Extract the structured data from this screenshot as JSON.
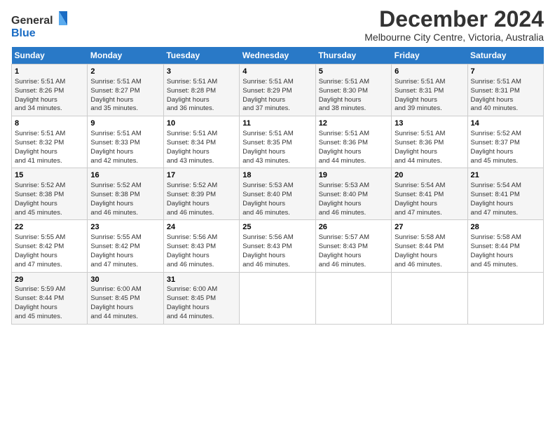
{
  "logo": {
    "line1": "General",
    "line2": "Blue"
  },
  "title": "December 2024",
  "subtitle": "Melbourne City Centre, Victoria, Australia",
  "weekdays": [
    "Sunday",
    "Monday",
    "Tuesday",
    "Wednesday",
    "Thursday",
    "Friday",
    "Saturday"
  ],
  "weeks": [
    [
      {
        "day": "1",
        "sunrise": "5:51 AM",
        "sunset": "8:26 PM",
        "daylight": "14 hours and 34 minutes."
      },
      {
        "day": "2",
        "sunrise": "5:51 AM",
        "sunset": "8:27 PM",
        "daylight": "14 hours and 35 minutes."
      },
      {
        "day": "3",
        "sunrise": "5:51 AM",
        "sunset": "8:28 PM",
        "daylight": "14 hours and 36 minutes."
      },
      {
        "day": "4",
        "sunrise": "5:51 AM",
        "sunset": "8:29 PM",
        "daylight": "14 hours and 37 minutes."
      },
      {
        "day": "5",
        "sunrise": "5:51 AM",
        "sunset": "8:30 PM",
        "daylight": "14 hours and 38 minutes."
      },
      {
        "day": "6",
        "sunrise": "5:51 AM",
        "sunset": "8:31 PM",
        "daylight": "14 hours and 39 minutes."
      },
      {
        "day": "7",
        "sunrise": "5:51 AM",
        "sunset": "8:31 PM",
        "daylight": "14 hours and 40 minutes."
      }
    ],
    [
      {
        "day": "8",
        "sunrise": "5:51 AM",
        "sunset": "8:32 PM",
        "daylight": "14 hours and 41 minutes."
      },
      {
        "day": "9",
        "sunrise": "5:51 AM",
        "sunset": "8:33 PM",
        "daylight": "14 hours and 42 minutes."
      },
      {
        "day": "10",
        "sunrise": "5:51 AM",
        "sunset": "8:34 PM",
        "daylight": "14 hours and 43 minutes."
      },
      {
        "day": "11",
        "sunrise": "5:51 AM",
        "sunset": "8:35 PM",
        "daylight": "14 hours and 43 minutes."
      },
      {
        "day": "12",
        "sunrise": "5:51 AM",
        "sunset": "8:36 PM",
        "daylight": "14 hours and 44 minutes."
      },
      {
        "day": "13",
        "sunrise": "5:51 AM",
        "sunset": "8:36 PM",
        "daylight": "14 hours and 44 minutes."
      },
      {
        "day": "14",
        "sunrise": "5:52 AM",
        "sunset": "8:37 PM",
        "daylight": "14 hours and 45 minutes."
      }
    ],
    [
      {
        "day": "15",
        "sunrise": "5:52 AM",
        "sunset": "8:38 PM",
        "daylight": "14 hours and 45 minutes."
      },
      {
        "day": "16",
        "sunrise": "5:52 AM",
        "sunset": "8:38 PM",
        "daylight": "14 hours and 46 minutes."
      },
      {
        "day": "17",
        "sunrise": "5:52 AM",
        "sunset": "8:39 PM",
        "daylight": "14 hours and 46 minutes."
      },
      {
        "day": "18",
        "sunrise": "5:53 AM",
        "sunset": "8:40 PM",
        "daylight": "14 hours and 46 minutes."
      },
      {
        "day": "19",
        "sunrise": "5:53 AM",
        "sunset": "8:40 PM",
        "daylight": "14 hours and 46 minutes."
      },
      {
        "day": "20",
        "sunrise": "5:54 AM",
        "sunset": "8:41 PM",
        "daylight": "14 hours and 47 minutes."
      },
      {
        "day": "21",
        "sunrise": "5:54 AM",
        "sunset": "8:41 PM",
        "daylight": "14 hours and 47 minutes."
      }
    ],
    [
      {
        "day": "22",
        "sunrise": "5:55 AM",
        "sunset": "8:42 PM",
        "daylight": "14 hours and 47 minutes."
      },
      {
        "day": "23",
        "sunrise": "5:55 AM",
        "sunset": "8:42 PM",
        "daylight": "14 hours and 47 minutes."
      },
      {
        "day": "24",
        "sunrise": "5:56 AM",
        "sunset": "8:43 PM",
        "daylight": "14 hours and 46 minutes."
      },
      {
        "day": "25",
        "sunrise": "5:56 AM",
        "sunset": "8:43 PM",
        "daylight": "14 hours and 46 minutes."
      },
      {
        "day": "26",
        "sunrise": "5:57 AM",
        "sunset": "8:43 PM",
        "daylight": "14 hours and 46 minutes."
      },
      {
        "day": "27",
        "sunrise": "5:58 AM",
        "sunset": "8:44 PM",
        "daylight": "14 hours and 46 minutes."
      },
      {
        "day": "28",
        "sunrise": "5:58 AM",
        "sunset": "8:44 PM",
        "daylight": "14 hours and 45 minutes."
      }
    ],
    [
      {
        "day": "29",
        "sunrise": "5:59 AM",
        "sunset": "8:44 PM",
        "daylight": "14 hours and 45 minutes."
      },
      {
        "day": "30",
        "sunrise": "6:00 AM",
        "sunset": "8:45 PM",
        "daylight": "14 hours and 44 minutes."
      },
      {
        "day": "31",
        "sunrise": "6:00 AM",
        "sunset": "8:45 PM",
        "daylight": "14 hours and 44 minutes."
      },
      null,
      null,
      null,
      null
    ]
  ],
  "labels": {
    "sunrise": "Sunrise:",
    "sunset": "Sunset:",
    "daylight": "Daylight hours"
  }
}
